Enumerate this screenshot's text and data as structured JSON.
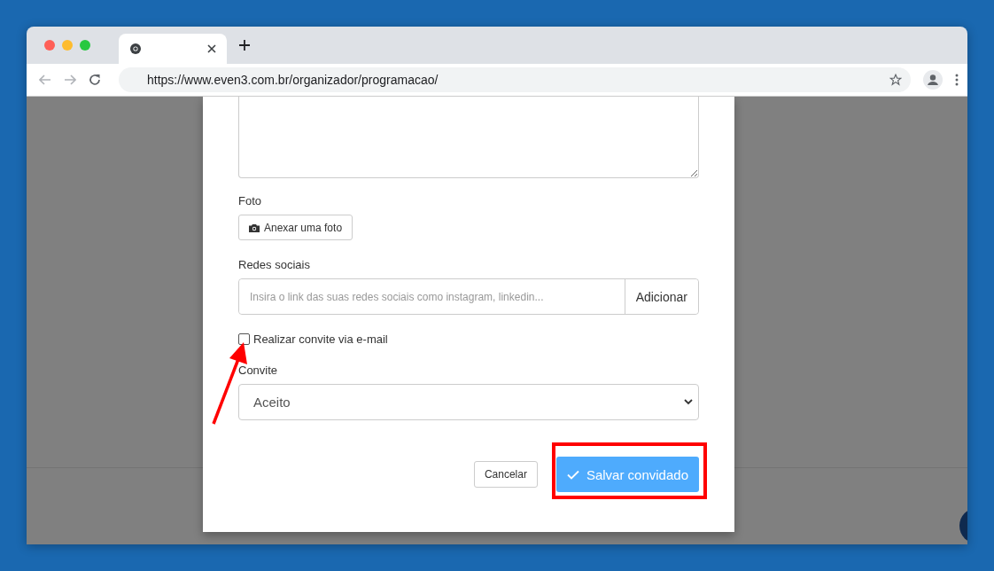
{
  "browser": {
    "url": "https://www.even3.com.br/organizador/programacao/"
  },
  "form": {
    "photo": {
      "label": "Foto",
      "button": "Anexar uma foto"
    },
    "social": {
      "label": "Redes sociais",
      "placeholder": "Insira o link das suas redes sociais como instagram, linkedin...",
      "button": "Adicionar"
    },
    "email_invite": {
      "label": "Realizar convite via e-mail",
      "checked": false
    },
    "invite": {
      "label": "Convite",
      "value": "Aceito"
    },
    "buttons": {
      "cancel": "Cancelar",
      "save": "Salvar convidado"
    }
  }
}
